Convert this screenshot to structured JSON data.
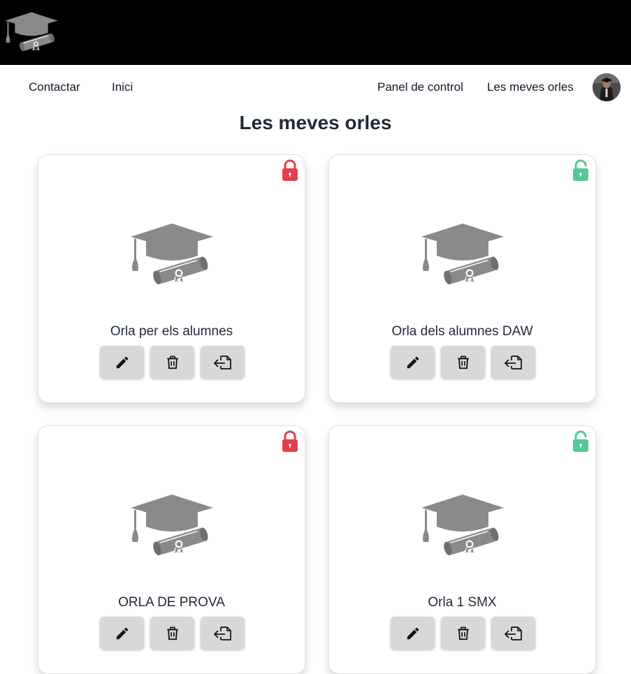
{
  "app": {
    "logo_icon": "graduation-cap-diploma-icon"
  },
  "nav": {
    "left": [
      {
        "label": "Contactar"
      },
      {
        "label": "Inici"
      }
    ],
    "right": [
      {
        "label": "Panel de control"
      },
      {
        "label": "Les meves orles"
      }
    ],
    "avatar_icon": "user-avatar"
  },
  "page": {
    "title": "Les meves orles"
  },
  "colors": {
    "locked": "#e5404a",
    "unlocked": "#52c994",
    "cap": "#8a8a8a",
    "button_bg": "#d8d8d8",
    "topbar": "#000000"
  },
  "cards": [
    {
      "title": "Orla per els alumnes",
      "status": "locked",
      "status_icon": "lock-closed-icon"
    },
    {
      "title": "Orla dels alumnes DAW",
      "status": "unlocked",
      "status_icon": "lock-open-icon"
    },
    {
      "title": "ORLA DE PROVA",
      "status": "locked",
      "status_icon": "lock-closed-icon"
    },
    {
      "title": "Orla 1 SMX",
      "status": "unlocked",
      "status_icon": "lock-open-icon"
    }
  ],
  "card_actions": [
    "edit-pencil-icon",
    "delete-trash-icon",
    "export-icon"
  ]
}
